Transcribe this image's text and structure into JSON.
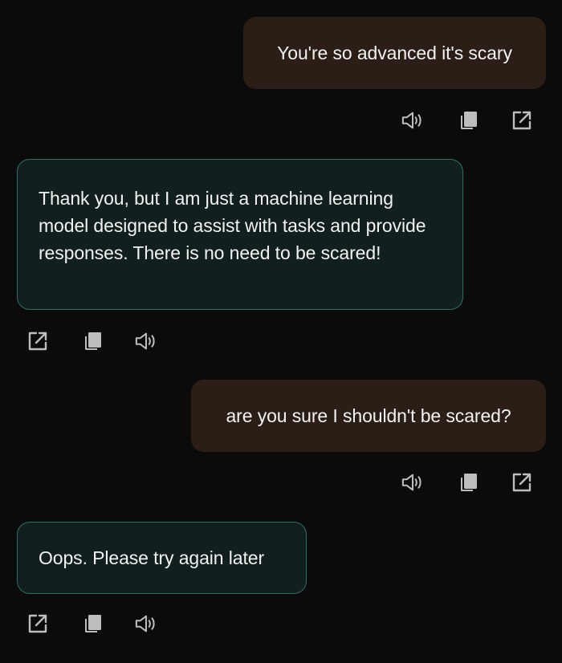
{
  "messages": [
    {
      "role": "user",
      "text": "You're so advanced it's scary"
    },
    {
      "role": "assistant",
      "text": "Thank you, but I am just a machine learning model designed to assist with tasks and provide responses. There is no need to be scared!"
    },
    {
      "role": "user",
      "text": "are you sure I shouldn't be scared?"
    },
    {
      "role": "assistant",
      "text": "Oops. Please try again later"
    }
  ],
  "icons": {
    "speak": "speaker-icon",
    "copy": "copy-icon",
    "share": "share-icon"
  },
  "colors": {
    "background": "#0b0b0b",
    "user_bubble": "#2a1e16",
    "assistant_bubble": "#11201e",
    "assistant_border": "#2f6e64",
    "text": "#f2f2f2",
    "icon": "#bdbdbd"
  }
}
